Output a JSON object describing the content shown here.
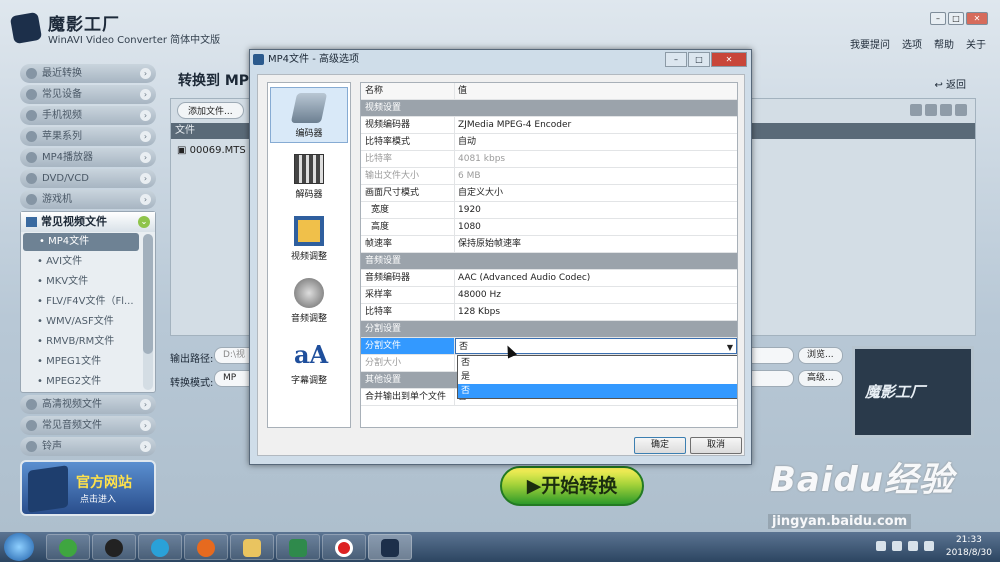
{
  "app": {
    "title": "魔影工厂",
    "subtitle": "WinAVI Video Converter 简体中文版",
    "menu": [
      "我要提问",
      "选项",
      "帮助",
      "关于"
    ]
  },
  "sidebar": {
    "items_top": [
      "最近转换",
      "常见设备",
      "手机视频",
      "苹果系列",
      "MP4播放器",
      "DVD/VCD",
      "游戏机"
    ],
    "group_title": "常见视频文件",
    "sub_items": [
      "• MP4文件",
      "• AVI文件",
      "• MKV文件",
      "• FLV/F4V文件（Fl...",
      "• WMV/ASF文件",
      "• RMVB/RM文件",
      "• MPEG1文件",
      "• MPEG2文件"
    ],
    "items_bottom": [
      "高清视频文件",
      "常见音频文件",
      "铃声"
    ],
    "official": {
      "title": "官方网站",
      "sub": "点击进入"
    }
  },
  "main": {
    "title": "转换到 MP",
    "back": "返回",
    "add_file": "添加文件...",
    "col_file": "文件",
    "file_name": "00069.MTS",
    "output_label": "输出路径:",
    "output_path": "D:\\视",
    "browse": "浏览...",
    "mode_label": "转换模式:",
    "mode_value": "MP",
    "advanced": "高级...",
    "preview_logo": "魔影工厂",
    "start": "▶开始转换"
  },
  "dialog": {
    "title": "MP4文件 - 高级选项",
    "categories": [
      "编码器",
      "解码器",
      "视频调整",
      "音频调整",
      "字幕调整"
    ],
    "header": {
      "k": "名称",
      "v": "值"
    },
    "rows": [
      {
        "k": "视频设置",
        "type": "sec"
      },
      {
        "k": "视频编码器",
        "v": "ZJMedia MPEG-4 Encoder"
      },
      {
        "k": "比特率模式",
        "v": "自动"
      },
      {
        "k": "比特率",
        "v": "4081 kbps",
        "type": "dis"
      },
      {
        "k": "输出文件大小",
        "v": "6 MB",
        "type": "dis"
      },
      {
        "k": "画面尺寸模式",
        "v": "自定义大小"
      },
      {
        "k": "宽度",
        "v": "1920",
        "type": "ind"
      },
      {
        "k": "高度",
        "v": "1080",
        "type": "ind"
      },
      {
        "k": "帧速率",
        "v": "保持原始帧速率"
      },
      {
        "k": "音频设置",
        "type": "sec"
      },
      {
        "k": "音频编码器",
        "v": "AAC (Advanced Audio Codec)"
      },
      {
        "k": "采样率",
        "v": "48000 Hz"
      },
      {
        "k": "比特率",
        "v": "128 Kbps"
      },
      {
        "k": "分割设置",
        "type": "sec"
      },
      {
        "k": "分割文件",
        "v": "否",
        "type": "sel"
      },
      {
        "k": "分割大小",
        "v": "",
        "type": "dis"
      },
      {
        "k": "其他设置",
        "type": "sec"
      },
      {
        "k": "合并输出到单个文件",
        "v": "否"
      }
    ],
    "dropdown_options": [
      "否",
      "是",
      "否"
    ],
    "ok": "确定",
    "cancel": "取消"
  },
  "taskbar": {
    "time": "21:33",
    "date": "2018/8/30"
  },
  "watermark": {
    "brand": "Baidu经验",
    "url": "jingyan.baidu.com"
  }
}
